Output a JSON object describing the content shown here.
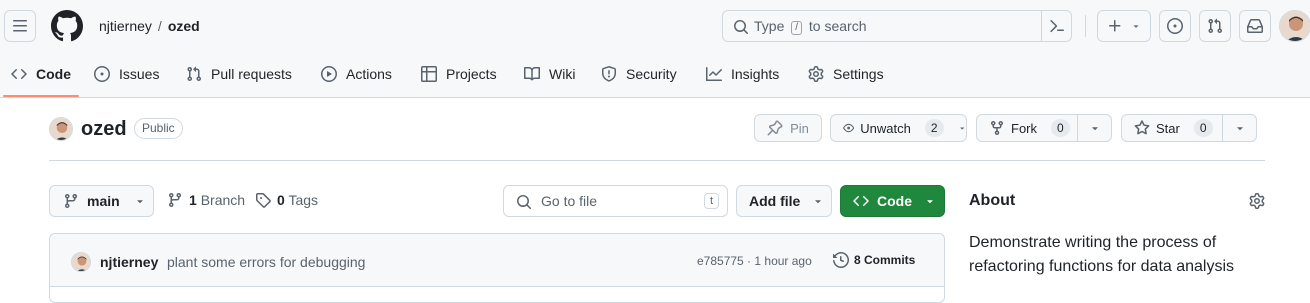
{
  "header": {
    "owner": "njtierney",
    "separator": "/",
    "repo": "ozed",
    "search": {
      "before": "Type",
      "key": "/",
      "after": "to search"
    }
  },
  "nav": {
    "tabs": [
      {
        "label": "Code",
        "icon": "code-icon",
        "active": true
      },
      {
        "label": "Issues",
        "icon": "issue-icon"
      },
      {
        "label": "Pull requests",
        "icon": "pull-request-icon"
      },
      {
        "label": "Actions",
        "icon": "play-icon"
      },
      {
        "label": "Projects",
        "icon": "table-icon"
      },
      {
        "label": "Wiki",
        "icon": "book-icon"
      },
      {
        "label": "Security",
        "icon": "shield-icon"
      },
      {
        "label": "Insights",
        "icon": "graph-icon"
      },
      {
        "label": "Settings",
        "icon": "gear-icon"
      }
    ]
  },
  "repo": {
    "name": "ozed",
    "visibility": "Public",
    "pin_label": "Pin",
    "watch_label": "Unwatch",
    "watch_count": "2",
    "fork_label": "Fork",
    "fork_count": "0",
    "star_label": "Star",
    "star_count": "0"
  },
  "toolbar": {
    "branch": "main",
    "branch_count": "1",
    "branch_word": "Branch",
    "tag_count": "0",
    "tag_word": "Tags",
    "goto_placeholder": "Go to file",
    "goto_key": "t",
    "add_file_label": "Add file",
    "code_label": "Code"
  },
  "commit": {
    "author": "njtierney",
    "message": "plant some errors for debugging",
    "meta": "e785775 · 1 hour ago",
    "commits_label": "8 Commits"
  },
  "about": {
    "title": "About",
    "description": "Demonstrate writing the process of refactoring functions for data analysis"
  },
  "colors": {
    "accent_green": "#1f883d",
    "tab_underline": "#fd8c73",
    "border": "#d1d9e0",
    "muted_text": "#59636e"
  }
}
